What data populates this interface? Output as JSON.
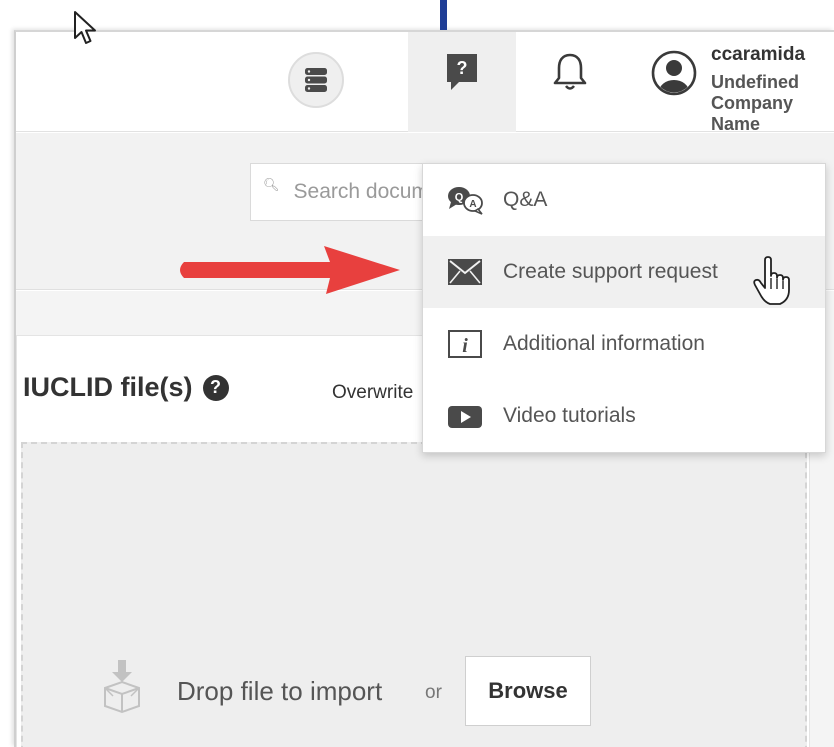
{
  "header": {
    "database_icon": "database-icon",
    "help_icon": "help-question-icon",
    "help_icon_glyph": "?",
    "notifications_icon": "bell-icon",
    "avatar_icon": "user-avatar-icon",
    "user": {
      "name": "ccaramida",
      "company": "Undefined Company Name"
    }
  },
  "toolbar": {
    "search_placeholder": "Search documents",
    "search_icon": "search-icon"
  },
  "help_menu": {
    "items": [
      {
        "label": "Q&A",
        "icon": "qa-bubbles-icon"
      },
      {
        "label": "Create support request",
        "icon": "envelope-icon",
        "hovered": true
      },
      {
        "label": "Additional information",
        "icon": "info-icon"
      },
      {
        "label": "Video tutorials",
        "icon": "video-play-icon"
      }
    ]
  },
  "import_panel": {
    "title": "IUCLID file(s)",
    "help_glyph": "?",
    "overwrite_label": "Overwrite",
    "drop_icon": "box-download-icon",
    "drop_text": "Drop file to import",
    "or_text": "or",
    "browse_label": "Browse"
  },
  "annotations": {
    "arrow_icon": "red-arrow-icon",
    "cursor_icon": "mouse-pointer-icon",
    "hand_icon": "hand-pointer-icon"
  },
  "colors": {
    "accent_blue": "#1f3e96",
    "annotation_red": "#e8403e",
    "icon_dark": "#4a4a4a"
  }
}
